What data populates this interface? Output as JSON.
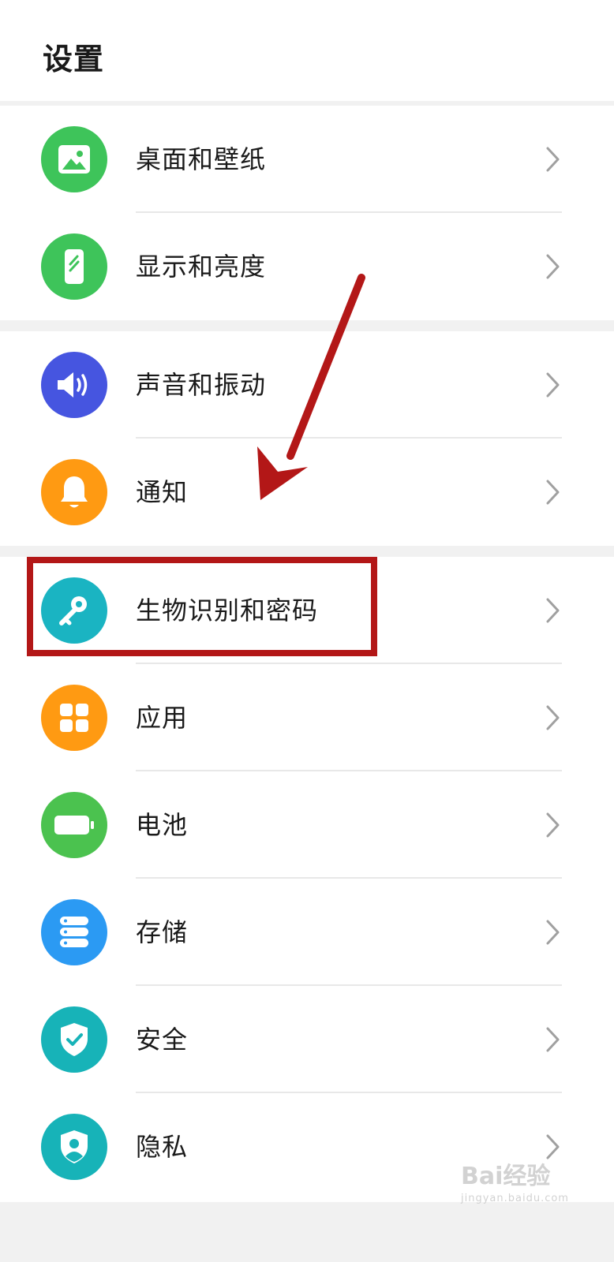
{
  "header": {
    "title": "设置"
  },
  "groups": [
    {
      "items": [
        {
          "id": "wallpaper",
          "label": "桌面和壁纸",
          "icon": "image-icon",
          "color": "#3ec45a"
        },
        {
          "id": "display",
          "label": "显示和亮度",
          "icon": "phone-display-icon",
          "color": "#3ec45a"
        }
      ]
    },
    {
      "items": [
        {
          "id": "sound",
          "label": "声音和振动",
          "icon": "speaker-icon",
          "color": "#4655e0"
        },
        {
          "id": "notifications",
          "label": "通知",
          "icon": "bell-icon",
          "color": "#ff9a12"
        }
      ]
    },
    {
      "items": [
        {
          "id": "biometrics",
          "label": "生物识别和密码",
          "icon": "key-icon",
          "color": "#1ab4c2"
        },
        {
          "id": "apps",
          "label": "应用",
          "icon": "apps-grid-icon",
          "color": "#ff9a12"
        },
        {
          "id": "battery",
          "label": "电池",
          "icon": "battery-icon",
          "color": "#4bc24f"
        },
        {
          "id": "storage",
          "label": "存储",
          "icon": "storage-icon",
          "color": "#2b9af3"
        },
        {
          "id": "security",
          "label": "安全",
          "icon": "shield-check-icon",
          "color": "#17b3b8"
        },
        {
          "id": "privacy",
          "label": "隐私",
          "icon": "privacy-shield-icon",
          "color": "#17b3b8"
        }
      ]
    }
  ],
  "annotation": {
    "highlight_item": "生物识别和密码",
    "highlight_color": "#b31717"
  },
  "watermark": {
    "brand": "Bai经验",
    "url": "jingyan.baidu.com"
  }
}
